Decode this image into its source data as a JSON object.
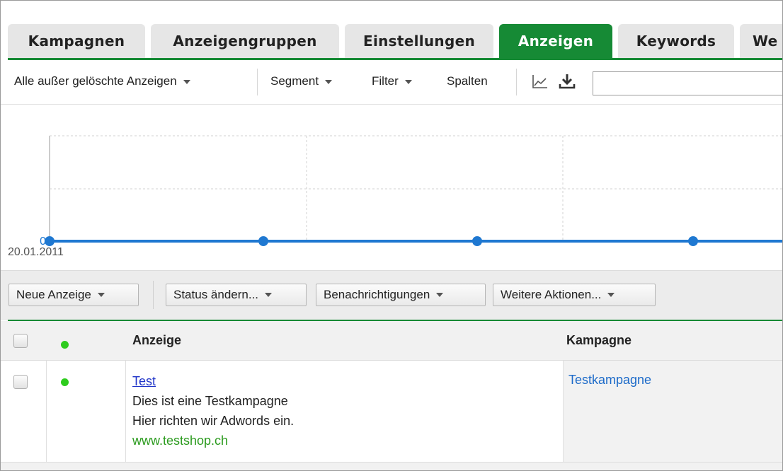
{
  "tabs": [
    {
      "label": "Kampagnen",
      "active": false
    },
    {
      "label": "Anzeigengruppen",
      "active": false
    },
    {
      "label": "Einstellungen",
      "active": false
    },
    {
      "label": "Anzeigen",
      "active": true
    },
    {
      "label": "Keywords",
      "active": false
    },
    {
      "label": "We",
      "active": false
    }
  ],
  "toolbar": {
    "view_filter": "Alle außer gelöschte Anzeigen",
    "segment": "Segment",
    "filter": "Filter",
    "columns": "Spalten",
    "chart_icon": "line-chart-icon",
    "download_icon": "download-icon",
    "search_value": ""
  },
  "chart": {
    "y_label": "0",
    "x_label": "20.01.2011",
    "line_color": "#1f78d1"
  },
  "actions": {
    "new_ad": "Neue Anzeige",
    "change_status": "Status ändern...",
    "notifications": "Benachrichtigungen",
    "more_actions": "Weitere Aktionen..."
  },
  "table": {
    "headers": {
      "ad": "Anzeige",
      "campaign": "Kampagne"
    },
    "rows": [
      {
        "status_color": "#2ecc1e",
        "ad_title": "Test",
        "ad_line1": "Dies ist eine Testkampagne",
        "ad_line2": "Hier richten wir Adwords ein.",
        "ad_url": "www.testshop.ch",
        "campaign": "Testkampagne"
      }
    ]
  },
  "colors": {
    "accent_green": "#168a35",
    "status_green": "#2ecc1e",
    "link_blue": "#1f33c8"
  }
}
